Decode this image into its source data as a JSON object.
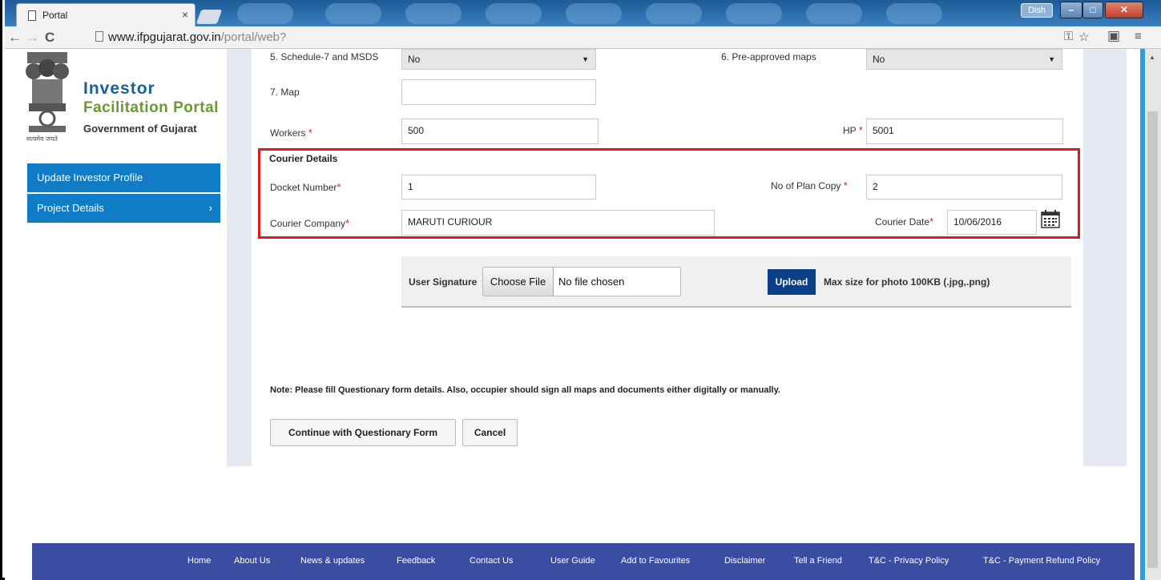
{
  "browser": {
    "tab_title": "Portal",
    "tab_close": "×",
    "user_badge": "Dish",
    "url_host": "www.ifpgujarat.gov.in",
    "url_path": "/portal/web?",
    "icons": [
      "back-icon",
      "forward-icon",
      "reload-icon",
      "page-icon",
      "key-icon",
      "star-icon",
      "extension-icon",
      "menu-icon"
    ]
  },
  "sidebar": {
    "logo": {
      "line1": "Investor",
      "line2": "Facilitation Portal",
      "line3": "Government of Gujarat",
      "motto": "सत्यमेव जयते"
    },
    "items": [
      {
        "label": "Update Investor Profile"
      },
      {
        "label": "Project Details",
        "chevron": "›"
      }
    ]
  },
  "form": {
    "schedule": {
      "label": "5. Schedule-7 and MSDS",
      "value": "No"
    },
    "preapproved": {
      "label": "6. Pre-approved maps",
      "value": "No"
    },
    "map": {
      "label": "7. Map",
      "value": ""
    },
    "workers": {
      "label": "Workers ",
      "value": "500"
    },
    "hp": {
      "label": "HP ",
      "value": "5001"
    },
    "required_mark": "*"
  },
  "courier": {
    "title": "Courier Details",
    "docket": {
      "label": "Docket Number",
      "value": "1"
    },
    "plan_copy": {
      "label": "No of Plan Copy ",
      "value": "2"
    },
    "company": {
      "label": "Courier Company",
      "value": "MARUTI CURIOUR"
    },
    "date": {
      "label": "Courier Date",
      "value": "10/06/2016"
    }
  },
  "upload": {
    "label": "User Signature",
    "choose_button": "Choose File",
    "no_file": "No file chosen",
    "upload_button": "Upload",
    "hint": "Max size for photo 100KB (.jpg,.png)"
  },
  "note": "Note: Please fill Questionary form details. Also, occupier should sign all maps and documents either digitally or manually.",
  "actions": {
    "continue": "Continue with Questionary Form",
    "cancel": "Cancel"
  },
  "footer": {
    "links": [
      "Home",
      "About Us",
      "News & updates",
      "Feedback",
      "Contact Us",
      "User Guide",
      "Add to Favourites",
      "Disclaimer",
      "Tell a Friend",
      "T&C - Privacy Policy",
      "T&C - Payment Refund Policy"
    ]
  },
  "colors": {
    "sidebar_blue": "#0f7cc5",
    "highlight_red": "#e01b1b",
    "footer_blue": "#3b4da3",
    "upload_blue": "#0b3f88"
  }
}
